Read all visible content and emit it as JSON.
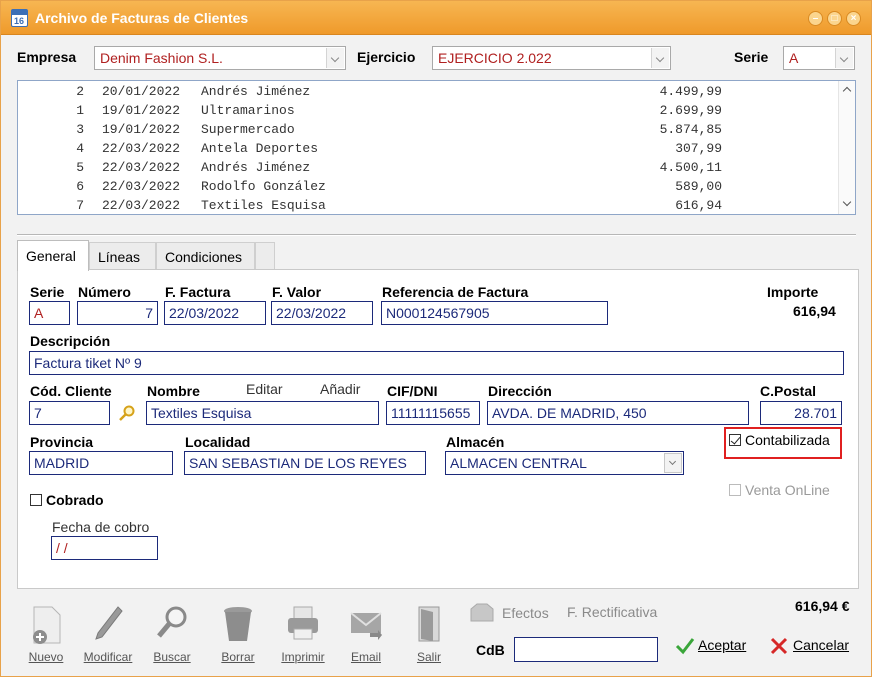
{
  "window": {
    "title": "Archivo de Facturas de Clientes",
    "icon_text": "16"
  },
  "header": {
    "empresa_label": "Empresa",
    "empresa_value": "Denim Fashion S.L.",
    "ejercicio_label": "Ejercicio",
    "ejercicio_value": "EJERCICIO 2.022",
    "serie_label": "Serie",
    "serie_value": "A"
  },
  "invoice_list": [
    {
      "num": "2",
      "date": "20/01/2022",
      "client": "Andrés Jiménez",
      "amount": "4.499,99"
    },
    {
      "num": "1",
      "date": "19/01/2022",
      "client": "Ultramarinos",
      "amount": "2.699,99"
    },
    {
      "num": "3",
      "date": "19/01/2022",
      "client": "Supermercado",
      "amount": "5.874,85"
    },
    {
      "num": "4",
      "date": "22/03/2022",
      "client": "Antela Deportes",
      "amount": "307,99"
    },
    {
      "num": "5",
      "date": "22/03/2022",
      "client": "Andrés Jiménez",
      "amount": "4.500,11"
    },
    {
      "num": "6",
      "date": "22/03/2022",
      "client": "Rodolfo González",
      "amount": "589,00"
    },
    {
      "num": "7",
      "date": "22/03/2022",
      "client": "Textiles Esquisa",
      "amount": "616,94"
    }
  ],
  "tabs": [
    "General",
    "Líneas",
    "Condiciones"
  ],
  "form": {
    "serie_label": "Serie",
    "serie_value": "A",
    "numero_label": "Número",
    "numero_value": "7",
    "ffactura_label": "F. Factura",
    "ffactura_value": "22/03/2022",
    "fvalor_label": "F. Valor",
    "fvalor_value": "22/03/2022",
    "referencia_label": "Referencia de Factura",
    "referencia_value": "N000124567905",
    "importe_label": "Importe",
    "importe_value": "616,94",
    "descripcion_label": "Descripción",
    "descripcion_value": "Factura tiket Nº 9",
    "codcliente_label": "Cód. Cliente",
    "codcliente_value": "7",
    "nombre_label": "Nombre",
    "nombre_value": "Textiles Esquisa",
    "editar_label": "Editar",
    "anadir_label": "Añadir",
    "cif_label": "CIF/DNI",
    "cif_value": "11111115655",
    "direccion_label": "Dirección",
    "direccion_value": "AVDA. DE MADRID, 450",
    "cpostal_label": "C.Postal",
    "cpostal_value": "28.701",
    "provincia_label": "Provincia",
    "provincia_value": "MADRID",
    "localidad_label": "Localidad",
    "localidad_value": "SAN SEBASTIAN DE LOS REYES",
    "almacen_label": "Almacén",
    "almacen_value": "ALMACEN CENTRAL",
    "contabilizada_label": "Contabilizada",
    "cobrado_label": "Cobrado",
    "ventaonline_label": "Venta OnLine",
    "fechacobro_label": "Fecha de cobro",
    "fechacobro_value": " / /"
  },
  "footer": {
    "total": "616,94 €",
    "efectos_label": "Efectos",
    "rectificativa_label": "F. Rectificativa",
    "cdb_label": "CdB",
    "cdb_value": "",
    "aceptar_label": "Aceptar",
    "cancelar_label": "Cancelar"
  },
  "toolbar": [
    "Nuevo",
    "Modificar",
    "Buscar",
    "Borrar",
    "Imprimir",
    "Email",
    "Salir"
  ],
  "colors": {
    "title_bar": "#ef9a2b",
    "field_border": "#1c2a7a",
    "highlight_box": "#e02020"
  }
}
